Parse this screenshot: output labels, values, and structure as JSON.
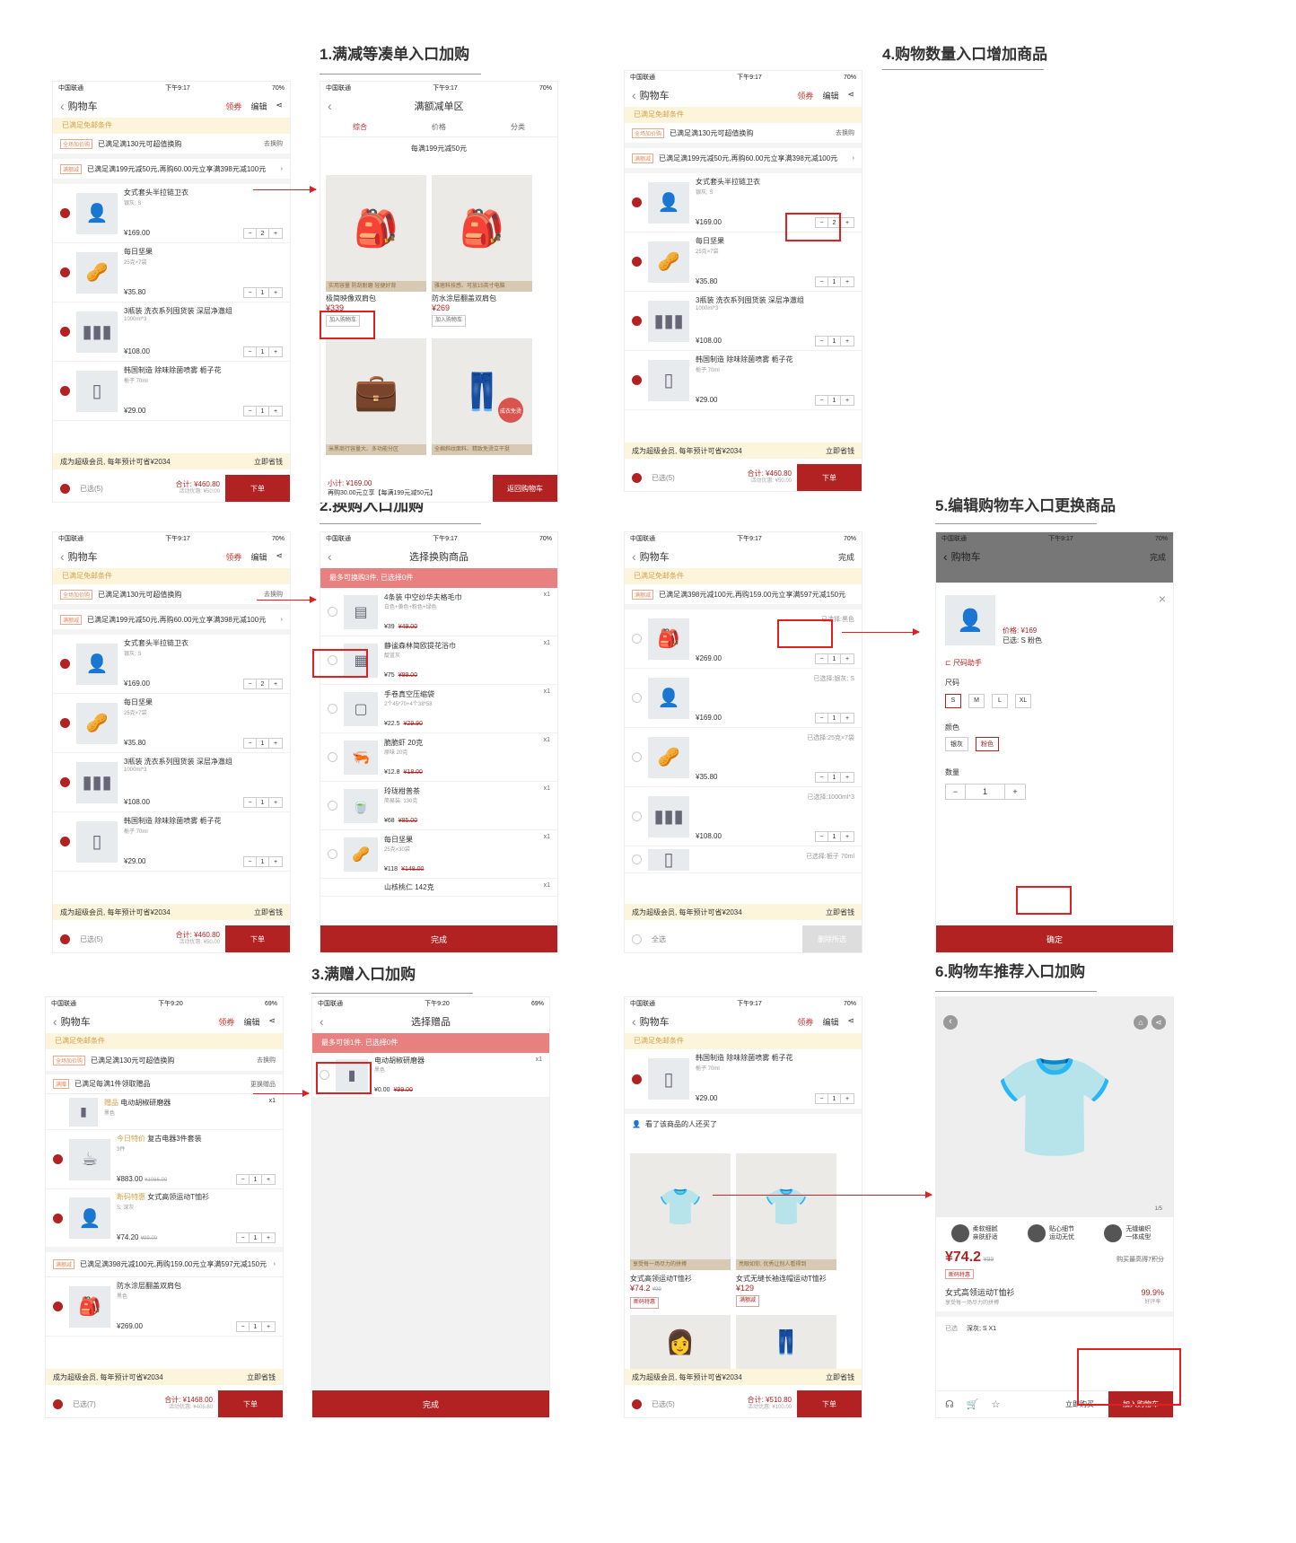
{
  "headings": {
    "h1": "1.满减等凑单入口加购",
    "h2": "2.换购入口加购",
    "h3": "3.满赠入口加购",
    "h4": "4.购物数量入口增加商品",
    "h5": "5.编辑购物车入口更换商品",
    "h6": "6.购物车推荐入口加购"
  },
  "common": {
    "carrier": "中国联通",
    "time": "下午9:17",
    "time2": "下午9:20",
    "battery": "70%",
    "battery2": "69%",
    "cart_title": "购物车",
    "coupon": "领券",
    "edit": "编辑",
    "done_edit": "完成",
    "free_ship": "已满足免邮条件",
    "tag_exchange": "全场加价购",
    "exchange_text": "已满足满130元可超值换购",
    "exchange_action": "去换购",
    "tag_discount": "满额减",
    "discount_text": "已满足满199元减50元,再购60.00元立享满398元减100元",
    "vip_text": "成为超级会员, 每年预计可省¥2034",
    "vip_action": "立即省钱",
    "selected": "已选(5)",
    "total": "合计: ¥460.80",
    "discount_total": "活动优惠: ¥50.00",
    "order": "下单",
    "qty1": "1",
    "qty2": "2"
  },
  "cart_items": [
    {
      "name": "女式套头半拉链卫衣",
      "spec": "银灰; S",
      "price": "¥169.00",
      "qty": "2"
    },
    {
      "name": "每日坚果",
      "spec": "25克×7袋",
      "price": "¥35.80",
      "qty": "1"
    },
    {
      "name": "3瓶装 洗衣系列囤货装 深层净澈组",
      "spec": "1000ml*3",
      "price": "¥108.00",
      "qty": "1"
    },
    {
      "name": "韩国制造 除味除菌喷雾 栀子花",
      "spec": "栀子 70ml",
      "price": "¥29.00",
      "qty": "1"
    }
  ],
  "screen1b": {
    "title": "满额减单区",
    "tabs": [
      "综合",
      "价格",
      "分类"
    ],
    "banner": "每满199元减50元",
    "p1_band": "实用容量 防刮耐磨 轻便好背",
    "p1_name": "极简映像双肩包",
    "p1_price": "¥339",
    "p2_band": "雅痞科技感、可放15英寸电脑",
    "p2_name": "防水涂层翻盖双肩包",
    "p2_price": "¥269",
    "add_cart": "加入购物车",
    "p3_band": "米黑商行容量大、多功能分区",
    "p4_band": "全棉斜纹面料、精致免烫立干挺",
    "p4_badge": "成衣免烫",
    "subtotal": "小计: ¥169.00",
    "tip": "再购30.00元立享【每满199元减50元】",
    "back": "返回购物车"
  },
  "screen2b": {
    "title": "选择换购商品",
    "bar": "最多可换购3件, 已选择0件",
    "items": [
      {
        "name": "4条装 中空纱华夫格毛巾",
        "spec": "白色+黄色+粉色+绿色",
        "price": "¥39",
        "old": "¥49.00"
      },
      {
        "name": "静谧森林简欧提花浴巾",
        "spec": "靛蓝灰",
        "price": "¥75",
        "old": "¥99.00"
      },
      {
        "name": "手卷真空压缩袋",
        "spec": "2个45*70+4个38*58",
        "price": "¥22.5",
        "old": "¥29.90"
      },
      {
        "name": "脆脆虾 20克",
        "spec": "原味 20克",
        "price": "¥12.8",
        "old": "¥18.00"
      },
      {
        "name": "玲珑柑普茶",
        "spec": "简易装: 130克",
        "price": "¥68",
        "old": "¥85.00"
      },
      {
        "name": "每日坚果",
        "spec": "25克×30袋",
        "price": "¥118",
        "old": "¥148.00"
      },
      {
        "name": "山核桃仁 142克",
        "spec": "",
        "price": "",
        "old": ""
      }
    ],
    "x1": "x1",
    "done": "完成"
  },
  "screen3a": {
    "tag_gift": "满赠",
    "gift_text": "已满足每满1件领取赠品",
    "gift_action": "更换赠品",
    "gift_label": "赠品",
    "gift_name": "电动胡椒研磨器",
    "gift_spec": "黑色",
    "x1": "x1",
    "i1_tag": "今日特价",
    "i1_name": "复古电器3件套装",
    "i1_spec": "3件",
    "i1_price": "¥883.00",
    "i1_old": "¥1066.00",
    "i2_tag": "断码特惠",
    "i2_name": "女式高领运动T恤衫",
    "i2_spec": "S; 深灰",
    "i2_price": "¥74.20",
    "i2_old": "¥99.00",
    "disc2": "已满足满398元减100元,再购159.00元立享满597元减150元",
    "i3_name": "防水涂层翻盖双肩包",
    "i3_spec": "黑色",
    "i3_price": "¥269.00",
    "selected": "已选(7)",
    "total": "合计: ¥1468.00",
    "discount_total": "活动优惠: ¥405.80"
  },
  "screen3b": {
    "title": "选择赠品",
    "bar": "最多可领1件, 已选择0件",
    "name": "电动胡椒研磨器",
    "spec": "黑色",
    "price": "¥0.00",
    "old": "¥99.00",
    "x1": "x1",
    "done": "完成"
  },
  "screen5a": {
    "disc": "已满足满398元减100元,再购159.00元立享满597元减150元",
    "specs": [
      "已选择:黑色",
      "已选择:银灰; S",
      "已选择:25克×7袋",
      "已选择:1000ml*3",
      "已选择:栀子 70ml"
    ],
    "prices": [
      "¥269.00",
      "¥169.00",
      "¥35.80",
      "¥108.00"
    ],
    "all": "全选",
    "delete": "删除所选"
  },
  "screen5b": {
    "price": "价格: ¥169",
    "chosen": "已选: S 粉色",
    "size_help": "尺码助手",
    "size_label": "尺码",
    "sizes": [
      "S",
      "M",
      "L",
      "XL"
    ],
    "color_label": "颜色",
    "colors": [
      "银灰",
      "粉色"
    ],
    "qty_label": "数量",
    "qty": "1",
    "confirm": "确定"
  },
  "screen6a": {
    "also": "看了该商品的人还买了",
    "r1_band": "享受每一场尽力的拼搏",
    "r1_name": "女式高领运动T恤衫",
    "r1_price": "¥74.2",
    "r1_old": "¥99",
    "r1_tag": "断码特惠",
    "r2_band": "亮眼如你, 优秀让别人看得到",
    "r2_name": "女式无缝长袖连帽运动T恤衫",
    "r2_price": "¥129",
    "r2_tag": "满额减",
    "total": "合计: ¥510.80",
    "discount_total": "活动优惠: ¥100.00"
  },
  "screen6b": {
    "pager": "1/5",
    "f1": "柔软细腻 亲肤舒适",
    "f2": "贴心细节 运动无忧",
    "f3": "无缝编织 一体成型",
    "price": "¥74.2",
    "old": "¥99",
    "points": "购买最高得7积分",
    "tag": "断码特惠",
    "name": "女式高领运动T恤衫",
    "sub": "享受每一场尽力的拼搏",
    "rate": "99.9%",
    "rate_label": "好评率",
    "chosen_label": "已选",
    "chosen": "深灰; S X1",
    "buy_now": "立即购买",
    "add_cart": "加入购物车"
  }
}
